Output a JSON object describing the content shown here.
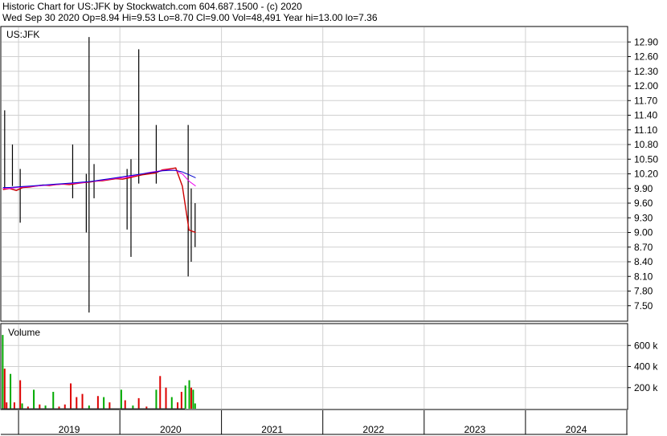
{
  "header": {
    "line1": "Historic Chart for US:JFK by Stockwatch.com 604.687.1500 - (c) 2020",
    "line2": "Wed Sep 30 2020  Op=8.94  Hi=9.53  Lo=8.70  Cl=9.00  Vol=48,491  Year hi=13.00  lo=7.36"
  },
  "chart_data": [
    {
      "type": "line",
      "title": "US:JFK",
      "subtype": "daily high-low bars with moving averages",
      "y_ticks": [
        "12.90",
        "12.60",
        "12.30",
        "12.00",
        "11.70",
        "11.40",
        "11.10",
        "10.80",
        "10.50",
        "10.20",
        "9.90",
        "9.60",
        "9.30",
        "9.00",
        "8.70",
        "8.40",
        "8.10",
        "7.80",
        "7.50"
      ],
      "ylim": [
        7.2,
        13.2
      ],
      "x_ticks": [
        "2019",
        "2020",
        "2021",
        "2022",
        "2023",
        "2024"
      ],
      "x_start": "2018-11-01",
      "x_end": "2024-12-31",
      "data_end": "2020-09-30",
      "year_hi": 13.0,
      "year_lo": 7.36,
      "series": [
        {
          "values": [
            9.88,
            9.9,
            9.86,
            9.92,
            9.93,
            9.95,
            9.97,
            9.96,
            9.98,
            9.99,
            9.98,
            10.0,
            10.02,
            10.03,
            10.05,
            10.06,
            10.08,
            10.1,
            10.09,
            10.12,
            10.15,
            10.18,
            10.2,
            10.22,
            10.28,
            10.3,
            10.32,
            9.95,
            9.05,
            9.0
          ],
          "color": "#cc0000"
        },
        {
          "values": [
            9.9,
            9.9,
            9.92,
            9.93,
            9.94,
            9.95,
            9.96,
            9.97,
            9.98,
            9.99,
            10.0,
            10.01,
            10.02,
            10.04,
            10.05,
            10.07,
            10.09,
            10.11,
            10.12,
            10.14,
            10.17,
            10.2,
            10.23,
            10.25,
            10.27,
            10.28,
            10.27,
            10.2,
            10.05,
            9.95
          ],
          "color": "#ee00ee"
        },
        {
          "values": [
            9.92,
            9.92,
            9.93,
            9.94,
            9.95,
            9.96,
            9.97,
            9.98,
            9.99,
            10.0,
            10.01,
            10.02,
            10.03,
            10.04,
            10.06,
            10.08,
            10.1,
            10.12,
            10.14,
            10.16,
            10.18,
            10.2,
            10.22,
            10.24,
            10.26,
            10.27,
            10.27,
            10.24,
            10.18,
            10.12
          ],
          "color": "#0000cc"
        }
      ],
      "spikes": [
        {
          "date": "2018-11-12",
          "high": 11.5,
          "low": 9.9
        },
        {
          "date": "2018-12-10",
          "high": 10.8,
          "low": 9.95
        },
        {
          "date": "2019-01-07",
          "high": 10.3,
          "low": 9.2
        },
        {
          "date": "2019-07-15",
          "high": 10.8,
          "low": 9.7
        },
        {
          "date": "2019-09-02",
          "high": 10.2,
          "low": 9.0
        },
        {
          "date": "2019-09-12",
          "high": 13.0,
          "low": 7.36
        },
        {
          "date": "2019-09-30",
          "high": 10.4,
          "low": 9.7
        },
        {
          "date": "2020-01-27",
          "high": 10.3,
          "low": 9.06
        },
        {
          "date": "2020-02-10",
          "high": 10.5,
          "low": 8.5
        },
        {
          "date": "2020-03-09",
          "high": 12.75,
          "low": 10.0
        },
        {
          "date": "2020-05-11",
          "high": 11.2,
          "low": 10.0
        },
        {
          "date": "2020-09-03",
          "high": 11.2,
          "low": 8.1
        },
        {
          "date": "2020-09-14",
          "high": 9.9,
          "low": 8.4
        },
        {
          "date": "2020-09-28",
          "high": 9.6,
          "low": 8.7
        }
      ]
    },
    {
      "type": "bar",
      "title": "Volume",
      "y_ticks": [
        "600 k",
        "400 k",
        "200 k"
      ],
      "ylim": [
        0,
        800000
      ],
      "up_color": "#00aa00",
      "down_color": "#dd0000",
      "bars": [
        {
          "date": "2018-11-05",
          "value": 700000,
          "up": true
        },
        {
          "date": "2018-11-12",
          "value": 380000,
          "up": false
        },
        {
          "date": "2018-11-19",
          "value": 60000,
          "up": false
        },
        {
          "date": "2018-12-03",
          "value": 330000,
          "up": true
        },
        {
          "date": "2018-12-17",
          "value": 60000,
          "up": false
        },
        {
          "date": "2019-01-07",
          "value": 270000,
          "up": false
        },
        {
          "date": "2019-01-14",
          "value": 50000,
          "up": true
        },
        {
          "date": "2019-02-04",
          "value": 20000,
          "up": false
        },
        {
          "date": "2019-02-25",
          "value": 180000,
          "up": true
        },
        {
          "date": "2019-03-18",
          "value": 40000,
          "up": false
        },
        {
          "date": "2019-04-08",
          "value": 30000,
          "up": true
        },
        {
          "date": "2019-05-06",
          "value": 160000,
          "up": true
        },
        {
          "date": "2019-05-27",
          "value": 20000,
          "up": false
        },
        {
          "date": "2019-06-17",
          "value": 40000,
          "up": false
        },
        {
          "date": "2019-07-08",
          "value": 240000,
          "up": false
        },
        {
          "date": "2019-07-29",
          "value": 110000,
          "up": false
        },
        {
          "date": "2019-08-19",
          "value": 140000,
          "up": false
        },
        {
          "date": "2019-09-12",
          "value": 30000,
          "up": true
        },
        {
          "date": "2019-10-14",
          "value": 120000,
          "up": false
        },
        {
          "date": "2019-11-04",
          "value": 110000,
          "up": true
        },
        {
          "date": "2019-11-25",
          "value": 60000,
          "up": false
        },
        {
          "date": "2020-01-06",
          "value": 180000,
          "up": true
        },
        {
          "date": "2020-01-20",
          "value": 80000,
          "up": false
        },
        {
          "date": "2020-02-17",
          "value": 30000,
          "up": true
        },
        {
          "date": "2020-03-09",
          "value": 100000,
          "up": false
        },
        {
          "date": "2020-04-06",
          "value": 20000,
          "up": false
        },
        {
          "date": "2020-05-11",
          "value": 180000,
          "up": true
        },
        {
          "date": "2020-05-25",
          "value": 310000,
          "up": false
        },
        {
          "date": "2020-06-15",
          "value": 200000,
          "up": false
        },
        {
          "date": "2020-07-06",
          "value": 110000,
          "up": true
        },
        {
          "date": "2020-07-27",
          "value": 60000,
          "up": false
        },
        {
          "date": "2020-08-10",
          "value": 160000,
          "up": false
        },
        {
          "date": "2020-08-24",
          "value": 220000,
          "up": true
        },
        {
          "date": "2020-09-07",
          "value": 270000,
          "up": true
        },
        {
          "date": "2020-09-14",
          "value": 200000,
          "up": false
        },
        {
          "date": "2020-09-21",
          "value": 180000,
          "up": true
        },
        {
          "date": "2020-09-28",
          "value": 50000,
          "up": true
        }
      ]
    }
  ]
}
